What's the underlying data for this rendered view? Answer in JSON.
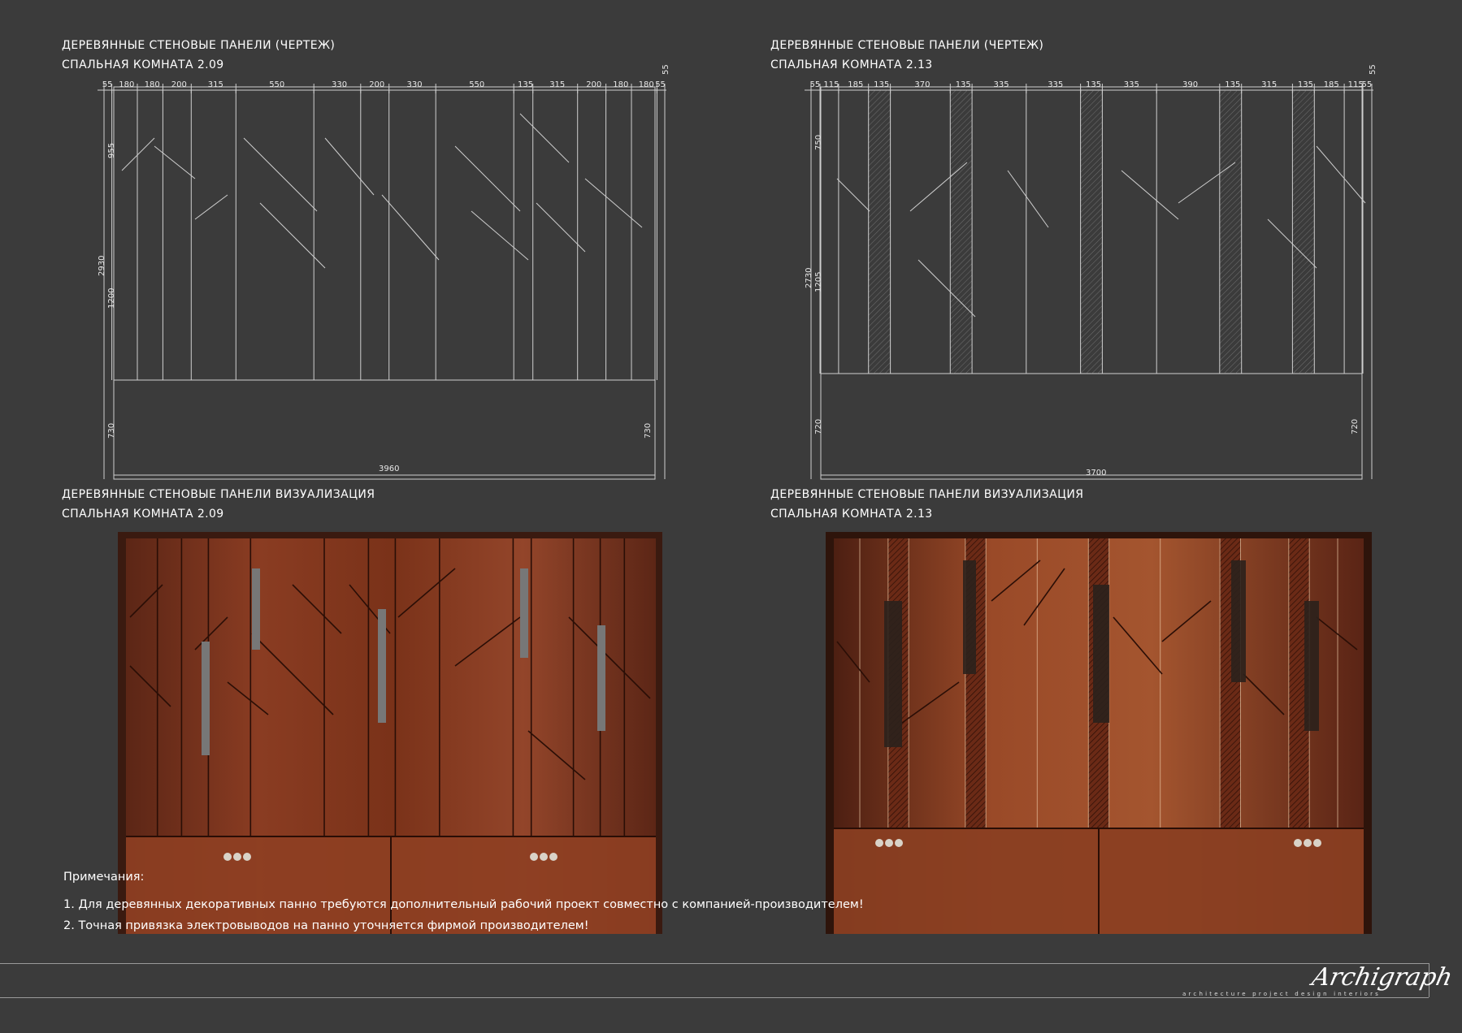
{
  "panels": {
    "drawing_left": {
      "title": "ДЕРЕВЯННЫЕ СТЕНОВЫЕ ПАНЕЛИ (ЧЕРТЕЖ)",
      "subtitle": "СПАЛЬНАЯ КОМНАТА 2.09",
      "top_dims": [
        "55",
        "180",
        "180",
        "200",
        "315",
        "550",
        "330",
        "200",
        "330",
        "550",
        "135",
        "315",
        "200",
        "180",
        "180",
        "55"
      ],
      "overall_width": "3960",
      "overall_height": "2930",
      "side_dims": [
        "955",
        "1200",
        "730",
        "730",
        "55"
      ]
    },
    "drawing_right": {
      "title": "ДЕРЕВЯННЫЕ СТЕНОВЫЕ ПАНЕЛИ (ЧЕРТЕЖ)",
      "subtitle": "СПАЛЬНАЯ КОМНАТА 2.13",
      "top_dims": [
        "55",
        "115",
        "185",
        "135",
        "370",
        "135",
        "335",
        "335",
        "135",
        "335",
        "390",
        "135",
        "315",
        "135",
        "185",
        "115",
        "55"
      ],
      "overall_width": "3700",
      "overall_height": "2730",
      "side_dims": [
        "750",
        "1205",
        "720",
        "720",
        "55"
      ]
    },
    "render_left": {
      "title": "ДЕРЕВЯННЫЕ СТЕНОВЫЕ ПАНЕЛИ ВИЗУАЛИЗАЦИЯ",
      "subtitle": "СПАЛЬНАЯ КОМНАТА 2.09"
    },
    "render_right": {
      "title": "ДЕРЕВЯННЫЕ СТЕНОВЫЕ ПАНЕЛИ ВИЗУАЛИЗАЦИЯ",
      "subtitle": "СПАЛЬНАЯ КОМНАТА 2.13"
    }
  },
  "notes": {
    "title": "Примечания:",
    "items": [
      "1. Для деревянных декоративных панно требуются дополнительный рабочий проект совместно с компанией-производителем!",
      "2. Точная привязка электровыводов на панно уточняется фирмой производителем!"
    ]
  },
  "brand": {
    "logo": "Archigraph",
    "tagline": "architecture   project   design   interiors"
  },
  "colors": {
    "background": "#3b3b3b",
    "wood_dark": "#5a2414",
    "wood_mid": "#8a3d22",
    "wood_light": "#a8552e",
    "line": "#cfcfcf"
  }
}
